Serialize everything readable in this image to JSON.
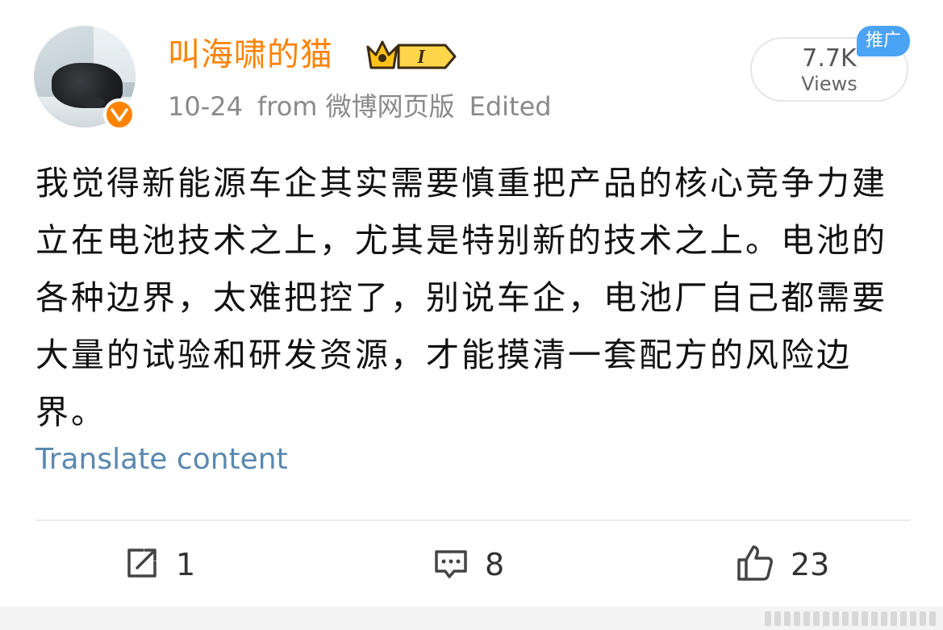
{
  "user": {
    "name": "叫海啸的猫",
    "level_label": "I"
  },
  "post_meta": {
    "date": "10-24",
    "source": "from 微博网页版",
    "edited": "Edited"
  },
  "views": {
    "count": "7.7K",
    "label": "Views"
  },
  "promo_tag": "推广",
  "post": {
    "text": "我觉得新能源车企其实需要慎重把产品的核心竞争力建立在电池技术之上，尤其是特别新的技术之上。电池的各种边界，太难把控了，别说车企，电池厂自己都需要大量的试验和研发资源，才能摸清一套配方的风险边界。"
  },
  "translate_label": "Translate content",
  "actions": {
    "repost_count": "1",
    "comment_count": "8",
    "like_count": "23"
  },
  "icons": {
    "repost": "repost-icon",
    "comment": "comment-icon",
    "like": "thumbs-up-icon",
    "verify": "verified-badge-icon",
    "crown": "crown-icon"
  },
  "colors": {
    "username": "#ff8200",
    "verify_badge": "#ff8200",
    "link": "#5a88b0",
    "promo_tag": "#4aa3f5",
    "meta_text": "#8a8a8a"
  }
}
